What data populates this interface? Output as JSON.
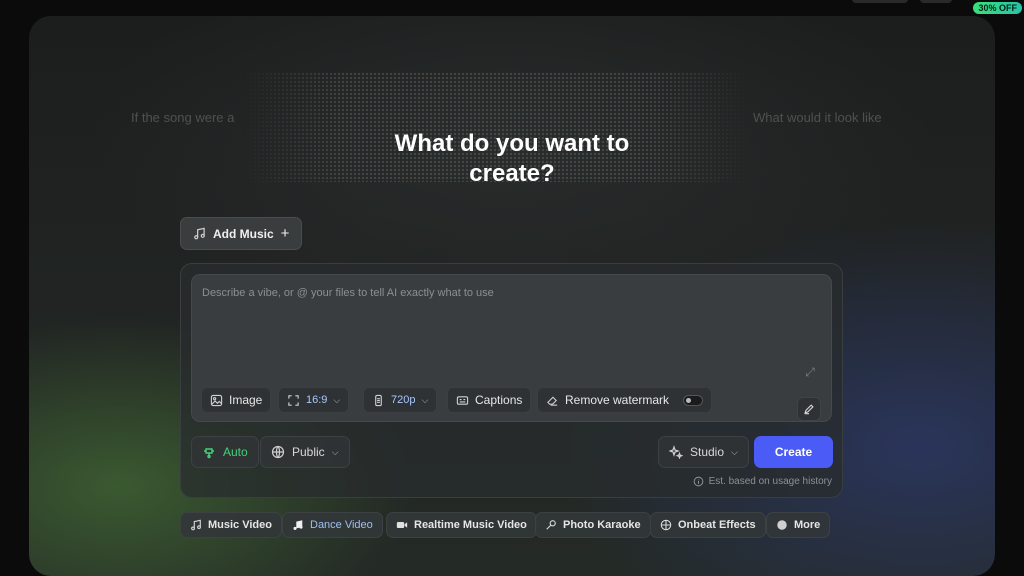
{
  "promo": {
    "badge": "30% OFF"
  },
  "hero": {
    "ghost_left": "If the song were a",
    "ghost_right": "What would it look like",
    "headline_line1": "What do you want to",
    "headline_line2": "create?"
  },
  "add_music": {
    "label": "Add Music"
  },
  "prompt": {
    "placeholder": "Describe a vibe, or @ your files to tell AI exactly what to use"
  },
  "options": {
    "image": "Image",
    "aspect": "16:9",
    "resolution": "720p",
    "captions": "Captions",
    "watermark": "Remove watermark",
    "watermark_on": false
  },
  "controls": {
    "auto": "Auto",
    "visibility": "Public",
    "mode": "Studio",
    "create": "Create",
    "estimate": "Est. based on usage history"
  },
  "modes": [
    {
      "label": "Music Video",
      "icon": "music-note-icon",
      "active": false
    },
    {
      "label": "Dance Video",
      "icon": "music-note-icon",
      "active": true
    },
    {
      "label": "Realtime Music Video",
      "icon": "camera-icon",
      "active": false
    },
    {
      "label": "Photo Karaoke",
      "icon": "microphone-icon",
      "active": false
    },
    {
      "label": "Onbeat Effects",
      "icon": "film-icon",
      "active": false
    },
    {
      "label": "More",
      "icon": "globe-icon",
      "active": false
    }
  ],
  "colors": {
    "accent": "#4a5cf5",
    "green": "#43d17a",
    "active_link": "#9fbff2"
  }
}
